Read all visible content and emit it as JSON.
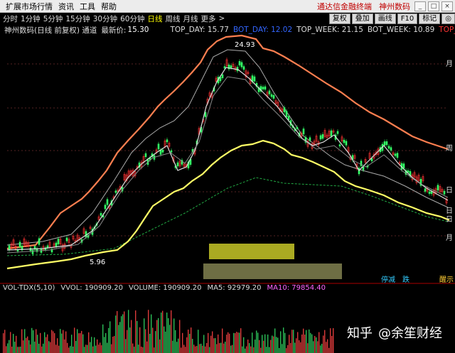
{
  "menu": {
    "items": [
      "扩展市场行情",
      "资讯",
      "工具",
      "帮助"
    ],
    "brand": [
      "通达信金融终端",
      "神州数码"
    ],
    "window_buttons": [
      "_",
      "□",
      "×"
    ]
  },
  "toolbar": {
    "periods": [
      "分时",
      "1分钟",
      "5分钟",
      "15分钟",
      "30分钟",
      "60分钟",
      "日线",
      "周线",
      "月线",
      "更多"
    ],
    "active": "日线",
    "more_arrow": ">",
    "right_buttons": [
      "复权",
      "叠加",
      "画线",
      "F10",
      "标记",
      "◎"
    ]
  },
  "info": {
    "stock": "神州数码(日线 前复权) 通道",
    "latest_label": "最新价:",
    "latest_value": "15.30",
    "top_day": "TOP_DAY: 15.77",
    "bot_day": "BOT_DAY: 12.02",
    "top_week": "TOP_WEEK: 21.15",
    "bot_week": "BOT_WEEK: 10.89",
    "top_c": "TOP_C..."
  },
  "chart": {
    "high_label": "24.93",
    "low_label": "5.96",
    "right_axis": [
      "月",
      "周",
      "日",
      "日",
      "日",
      "月"
    ],
    "bottom_tags": [
      "停减",
      "跌",
      "醒示"
    ],
    "colors": {
      "month_channel": "#ff7f50",
      "week_line": "#ffff66",
      "up_candle": "#ff3333",
      "down_candle": "#33ff66",
      "ma": "#cccccc"
    }
  },
  "volume": {
    "indicator": "VOL-TDX(5,10)",
    "vvol": "VVOL: 190909.20",
    "volume": "VOLUME: 190909.20",
    "ma5": "MA5: 92979.20",
    "ma10": "MA10: 79854.40"
  },
  "watermark": {
    "logo": "知乎",
    "author": "@余笙财经"
  }
}
